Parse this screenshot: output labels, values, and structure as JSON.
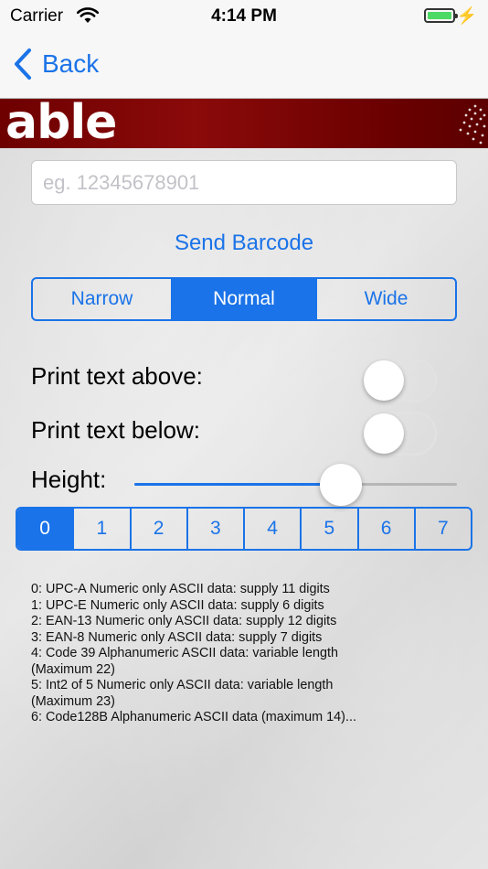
{
  "status_bar": {
    "carrier": "Carrier",
    "time": "4:14 PM"
  },
  "nav": {
    "back_label": "Back"
  },
  "banner": {
    "logo_text": "able",
    "brand_color": "#7a0000"
  },
  "barcode_input": {
    "value": "",
    "placeholder": "eg. 12345678901"
  },
  "send_button": {
    "label": "Send Barcode"
  },
  "width_segment": {
    "options": [
      "Narrow",
      "Normal",
      "Wide"
    ],
    "selected": "Normal"
  },
  "toggles": {
    "print_above": {
      "label": "Print text above:",
      "on": false
    },
    "print_below": {
      "label": "Print text below:",
      "on": false
    }
  },
  "height": {
    "label": "Height:",
    "value_fraction": 0.64
  },
  "type_segment": {
    "options": [
      "0",
      "1",
      "2",
      "3",
      "4",
      "5",
      "6",
      "7"
    ],
    "selected": "0"
  },
  "info_lines": [
    "0: UPC-A Numeric only ASCII data: supply 11 digits",
    "1: UPC-E Numeric only ASCII data: supply  6 digits",
    "2: EAN-13 Numeric only ASCII data: supply 12 digits",
    "3: EAN-8 Numeric only ASCII data: supply  7 digits",
    "4: Code 39 Alphanumeric ASCII data: variable length",
    "(Maximum 22)",
    "5: Int2 of 5 Numeric only ASCII data:  variable length",
    "(Maximum 23)",
    "6: Code128B Alphanumeric ASCII data (maximum 14)..."
  ],
  "accent_color": "#1a73e8"
}
